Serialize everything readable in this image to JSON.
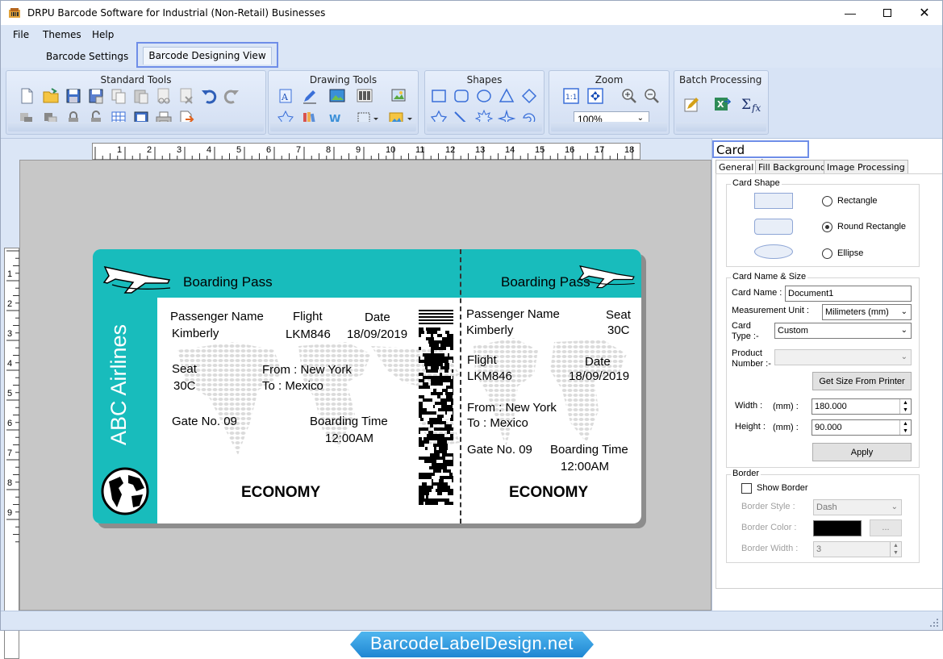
{
  "window": {
    "title": "DRPU Barcode Software for Industrial (Non-Retail) Businesses"
  },
  "menu": {
    "file": "File",
    "themes": "Themes",
    "help": "Help"
  },
  "tabs": {
    "settings": "Barcode Settings",
    "design": "Barcode Designing View"
  },
  "ribbon": {
    "standard": "Standard Tools",
    "drawing": "Drawing Tools",
    "shapes": "Shapes",
    "zoom": "Zoom",
    "zoom_value": "100%",
    "batch": "Batch Processing"
  },
  "ruler": {
    "h": [
      "1",
      "2",
      "3",
      "4",
      "5",
      "6",
      "7",
      "8",
      "9",
      "10",
      "11",
      "12",
      "13",
      "14",
      "15",
      "16",
      "17",
      "18"
    ],
    "v": [
      "1",
      "2",
      "3",
      "4",
      "5",
      "6",
      "7",
      "8",
      "9"
    ]
  },
  "card": {
    "airline": "ABC Airlines",
    "title_left": "Boarding Pass",
    "title_right": "Boarding Pass",
    "passenger_label": "Passenger Name",
    "passenger": "Kimberly",
    "flight_label": "Flight",
    "flight": "LKM846",
    "date_label": "Date",
    "date": "18/09/2019",
    "seat_label": "Seat",
    "seat": "30C",
    "from": "From : New York",
    "to": "To : Mexico",
    "gate": "Gate No. 09",
    "boarding_label": "Boarding Time",
    "boarding": "12:00AM",
    "class": "ECONOMY"
  },
  "panel": {
    "title": "Card Properties",
    "tabs": [
      "General",
      "Fill Background",
      "Image Processing"
    ],
    "shape_legend": "Card Shape",
    "shape_rect": "Rectangle",
    "shape_round": "Round Rectangle",
    "shape_ellipse": "Ellipse",
    "name_legend": "Card  Name & Size",
    "card_name_label": "Card Name :",
    "card_name": "Document1",
    "unit_label": "Measurement Unit :",
    "unit": "Milimeters (mm)",
    "card_type_label1": "Card",
    "card_type_label2": "Type :-",
    "card_type": "Custom",
    "product_label1": "Product",
    "product_label2": "Number :-",
    "get_size": "Get Size From Printer",
    "width_label": "Width :",
    "height_label": "Height :",
    "mm": "(mm) :",
    "width": "180.000",
    "height": "90.000",
    "apply": "Apply",
    "border_legend": "Border",
    "show_border": "Show Border",
    "border_style_label": "Border Style :",
    "border_style": "Dash",
    "border_color_label": "Border Color :",
    "border_width_label": "Border Width :",
    "border_width": "3",
    "ellipsis": "..."
  },
  "watermark": "BarcodeLabelDesign.net",
  "colors": {
    "teal": "#18bcbc",
    "ribbon": "#dbe6f6",
    "accent": "#6f8ee8"
  }
}
